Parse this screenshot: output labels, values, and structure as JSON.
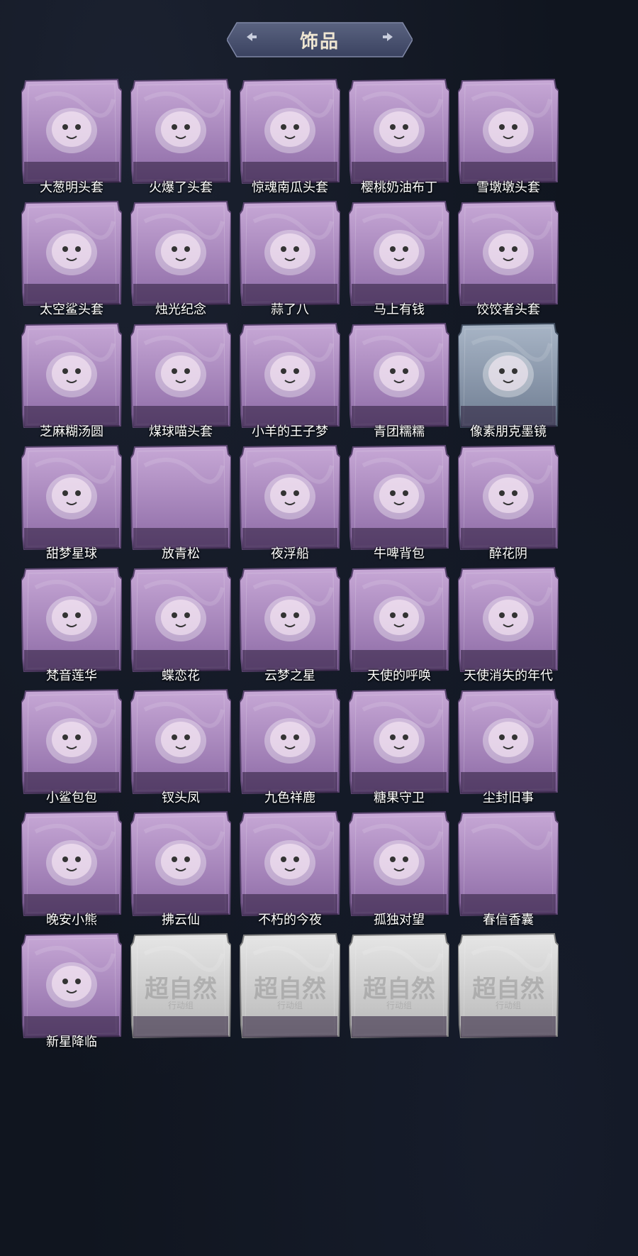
{
  "page": {
    "title": "饰品"
  },
  "colors": {
    "purple_frame": "#b795c9",
    "blue_frame": "#8fa0b5",
    "placeholder_frame": "#c9c9c9",
    "background": "#10151f"
  },
  "items": [
    {
      "label": "大葱明头套",
      "icon": "scallion-head-icon",
      "tier": "purple"
    },
    {
      "label": "火爆了头套",
      "icon": "fire-spirit-icon",
      "tier": "purple"
    },
    {
      "label": "惊魂南瓜头套",
      "icon": "pumpkin-head-icon",
      "tier": "purple"
    },
    {
      "label": "樱桃奶油布丁",
      "icon": "pudding-icon",
      "tier": "purple"
    },
    {
      "label": "雪墩墩头套",
      "icon": "snowman-head-icon",
      "tier": "purple"
    },
    {
      "label": "太空鲨头套",
      "icon": "shark-head-icon",
      "tier": "purple"
    },
    {
      "label": "烛光纪念",
      "icon": "candle-icon",
      "tier": "purple"
    },
    {
      "label": "蒜了八",
      "icon": "garlic-icon",
      "tier": "purple"
    },
    {
      "label": "马上有钱",
      "icon": "horse-head-icon",
      "tier": "purple"
    },
    {
      "label": "饺饺者头套",
      "icon": "dumpling-head-icon",
      "tier": "purple"
    },
    {
      "label": "芝麻糊汤圆",
      "icon": "rice-ball-icon",
      "tier": "purple"
    },
    {
      "label": "煤球喵头套",
      "icon": "black-cat-icon",
      "tier": "purple"
    },
    {
      "label": "小羊的王子梦",
      "icon": "sheep-crown-icon",
      "tier": "purple"
    },
    {
      "label": "青团糯糯",
      "icon": "green-rice-cake-icon",
      "tier": "purple"
    },
    {
      "label": "像素朋克墨镜",
      "icon": "pixel-sunglasses-icon",
      "tier": "blue"
    },
    {
      "label": "甜梦星球",
      "icon": "moon-dream-icon",
      "tier": "purple"
    },
    {
      "label": "放青松",
      "icon": "empty-icon",
      "tier": "purple"
    },
    {
      "label": "夜浮船",
      "icon": "jellyfish-icon",
      "tier": "purple"
    },
    {
      "label": "牛啤背包",
      "icon": "cow-beer-icon",
      "tier": "purple"
    },
    {
      "label": "醉花阴",
      "icon": "lantern-ornament-icon",
      "tier": "purple"
    },
    {
      "label": "梵音莲华",
      "icon": "lotus-charm-icon",
      "tier": "purple"
    },
    {
      "label": "蝶恋花",
      "icon": "bell-charm-icon",
      "tier": "purple"
    },
    {
      "label": "云梦之星",
      "icon": "unicorn-cloud-icon",
      "tier": "purple"
    },
    {
      "label": "天使的呼唤",
      "icon": "angel-icon",
      "tier": "purple"
    },
    {
      "label": "天使消失的年代",
      "icon": "veiled-doll-icon",
      "tier": "purple"
    },
    {
      "label": "小鲨包包",
      "icon": "shark-bag-icon",
      "tier": "purple"
    },
    {
      "label": "钗头凤",
      "icon": "phoenix-crown-doll-icon",
      "tier": "purple"
    },
    {
      "label": "九色祥鹿",
      "icon": "deer-charm-icon",
      "tier": "purple"
    },
    {
      "label": "糖果守卫",
      "icon": "candy-guard-icon",
      "tier": "purple"
    },
    {
      "label": "尘封旧事",
      "icon": "chibi-gentleman-icon",
      "tier": "purple"
    },
    {
      "label": "晚安小熊",
      "icon": "bear-charm-icon",
      "tier": "purple"
    },
    {
      "label": "拂云仙",
      "icon": "fairy-charm-icon",
      "tier": "purple"
    },
    {
      "label": "不朽的今夜",
      "icon": "pink-cat-icon",
      "tier": "purple"
    },
    {
      "label": "孤独对望",
      "icon": "silver-doll-icon",
      "tier": "purple"
    },
    {
      "label": "春信香囊",
      "icon": "empty-icon",
      "tier": "purple"
    },
    {
      "label": "新星降临",
      "icon": "star-doll-icon",
      "tier": "purple"
    },
    {
      "label": "",
      "icon": "placeholder-logo-icon",
      "tier": "placeholder",
      "ph_main": "超自然",
      "ph_sub": "行动组"
    },
    {
      "label": "",
      "icon": "placeholder-logo-icon",
      "tier": "placeholder",
      "ph_main": "超自然",
      "ph_sub": "行动组"
    },
    {
      "label": "",
      "icon": "placeholder-logo-icon",
      "tier": "placeholder",
      "ph_main": "超自然",
      "ph_sub": "行动组"
    },
    {
      "label": "",
      "icon": "placeholder-logo-icon",
      "tier": "placeholder",
      "ph_main": "超自然",
      "ph_sub": "行动组"
    }
  ]
}
